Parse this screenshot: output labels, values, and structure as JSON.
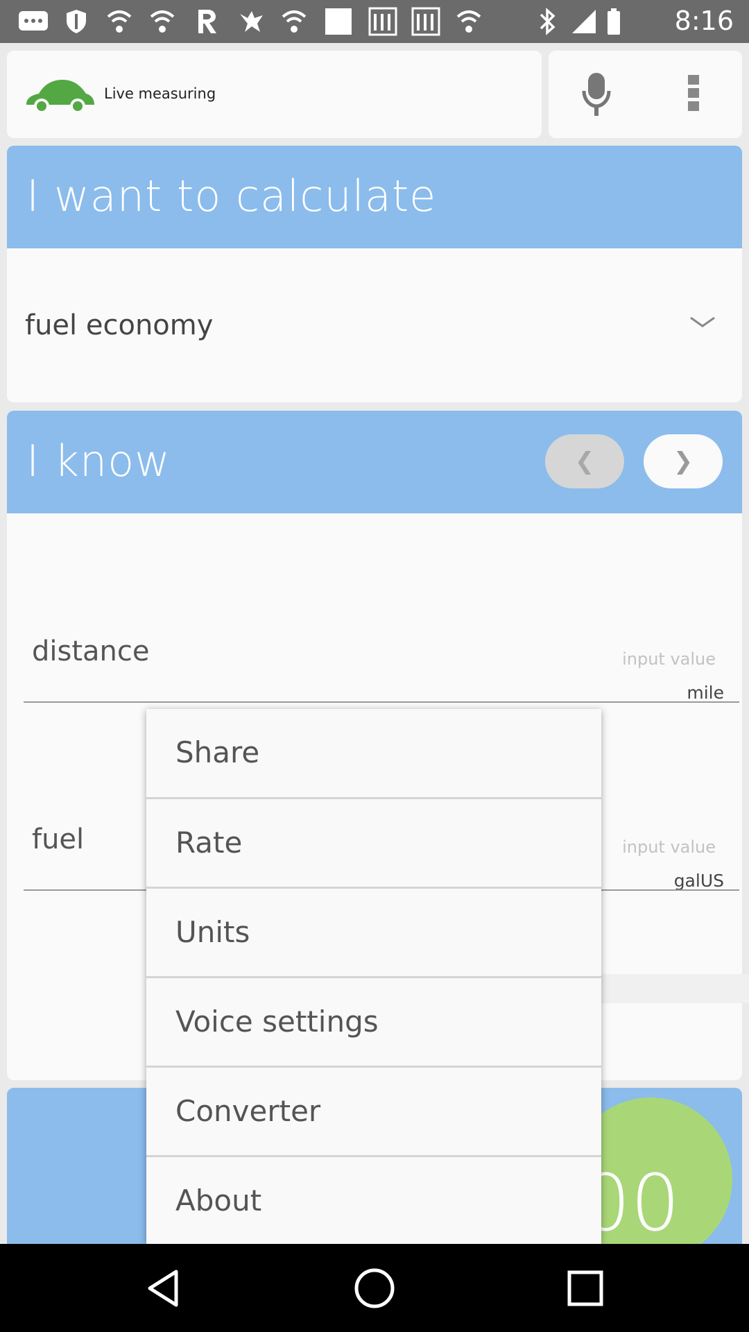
{
  "status_bar": {
    "time": "8:16",
    "icons": [
      "chat-icon",
      "shield-icon",
      "wifi-icon",
      "wifi-icon",
      "r-app-icon",
      "texans-icon",
      "wifi-icon",
      "square-icon",
      "rfi-icon",
      "rfi-icon",
      "wifi-icon",
      "bluetooth-icon",
      "signal-icon",
      "battery-icon"
    ]
  },
  "toolbar": {
    "live_label": "Live measuring",
    "car_icon": "car-icon",
    "mic_icon": "microphone-icon",
    "overflow_icon": "more-vert-icon"
  },
  "calculate_section": {
    "title": "I want to calculate",
    "selected": "fuel economy",
    "chevron_icon": "chevron-down-icon"
  },
  "know_section": {
    "title": "I know",
    "prev_glyph": "❮",
    "next_glyph": "❯",
    "fields": [
      {
        "label": "distance",
        "placeholder": "input value",
        "unit": "mile"
      },
      {
        "label": "fuel",
        "placeholder": "input value",
        "unit": "galUS"
      }
    ]
  },
  "result": {
    "value_visible": "00"
  },
  "menu": {
    "items": [
      "Share",
      "Rate",
      "Units",
      "Voice settings",
      "Converter",
      "About"
    ]
  },
  "nav": {
    "back": "back-icon",
    "home": "home-icon",
    "recents": "recents-icon"
  },
  "colors": {
    "header_blue": "#8bbcec",
    "car_green": "#53a843",
    "result_green": "#a9d778"
  }
}
